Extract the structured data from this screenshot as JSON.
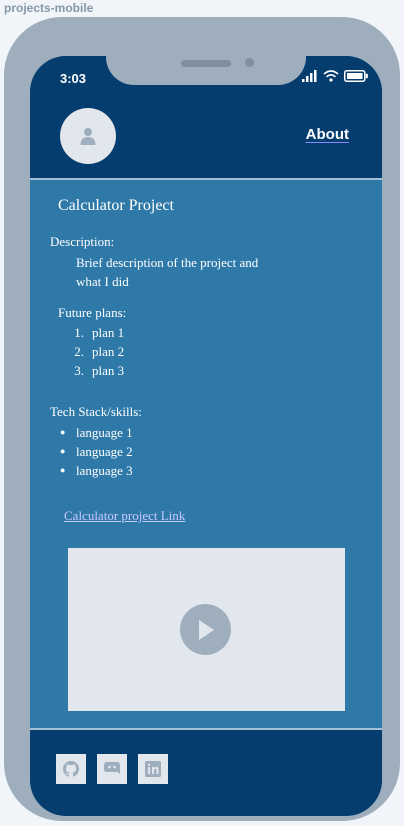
{
  "frame": {
    "label": "projects-mobile"
  },
  "status_bar": {
    "time": "3:03"
  },
  "header": {
    "about_label": "About"
  },
  "project": {
    "title": "Calculator Project",
    "description_label": "Description:",
    "description": "Brief description of the project and what I did",
    "future_label": "Future plans:",
    "plans": [
      "plan 1",
      "plan 2",
      "plan 3"
    ],
    "tech_label": "Tech Stack/skills:",
    "skills": [
      "language 1",
      "language 2",
      "language 3"
    ],
    "link_label": "Calculator project Link"
  },
  "footer": {
    "social_icons": [
      "github-icon",
      "discord-icon",
      "linkedin-icon"
    ]
  },
  "colors": {
    "header_bg": "#053d6e",
    "content_bg": "#2f79a9",
    "frame": "#9eaebd",
    "placeholder": "#e1e7ec"
  }
}
